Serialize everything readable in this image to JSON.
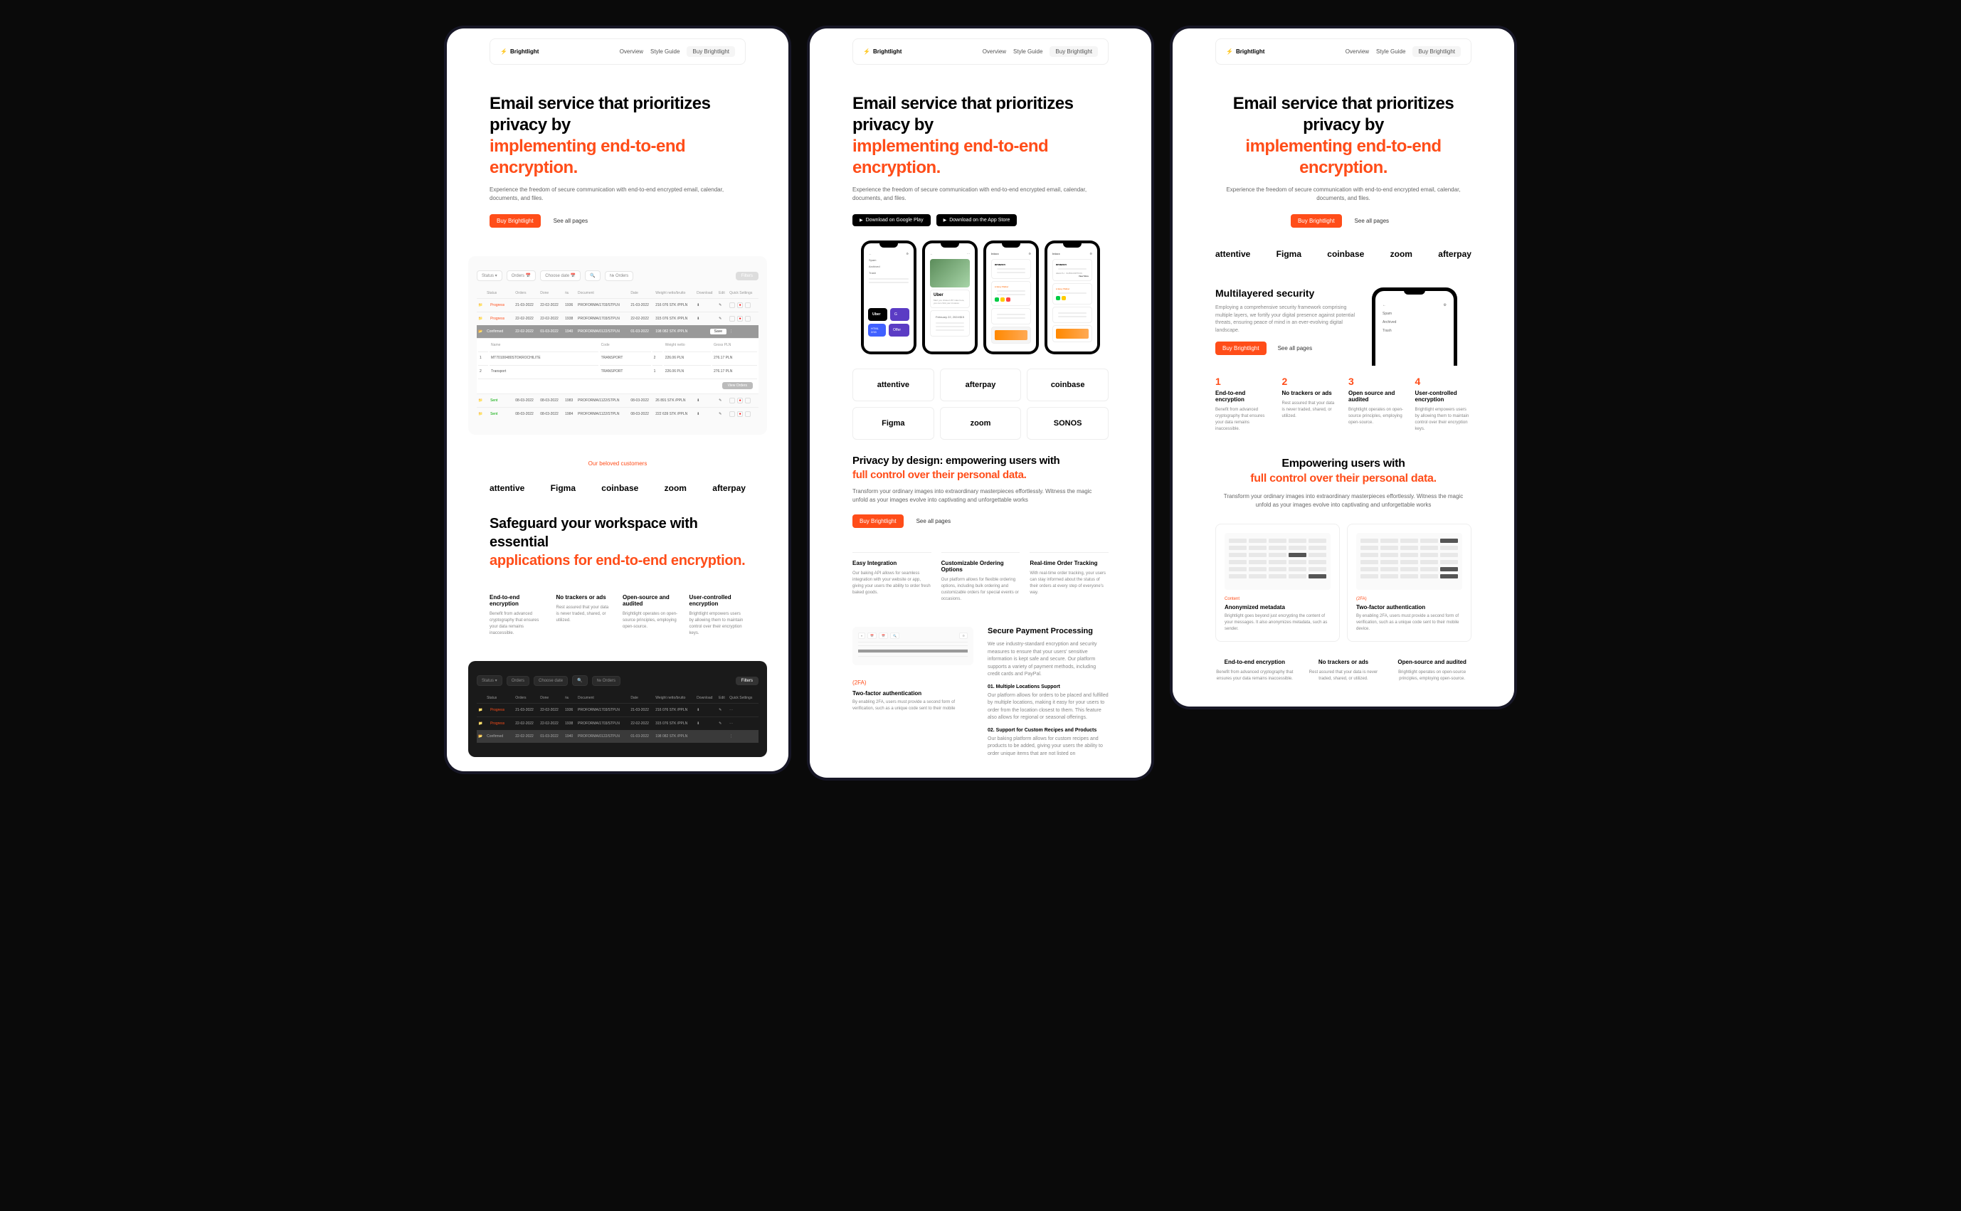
{
  "nav": {
    "brand": "Brightlight",
    "links": [
      "Overview",
      "Style Guide"
    ],
    "cta": "Buy Brightlight"
  },
  "hero": {
    "h1a": "Email service that prioritizes privacy by",
    "h1b": "implementing end-to-end encryption.",
    "sub": "Experience the freedom of secure communication with end-to-end encrypted email, calendar, documents, and files.",
    "cta": "Buy Brightlight",
    "cta2": "See all pages",
    "dl1": "Download on Google Play",
    "dl2": "Download on the App Store"
  },
  "customers": "Our beloved customers",
  "logos": [
    "attentive",
    "Figma",
    "coinbase",
    "zoom",
    "afterpay"
  ],
  "logos6": [
    "attentive",
    "afterpay",
    "coinbase",
    "Figma",
    "zoom",
    "SONOS"
  ],
  "dash": {
    "filters": [
      "Status",
      "Orders",
      "Choose date",
      "№ Orders"
    ],
    "filterBtn": "Filters",
    "cols": [
      "",
      "Status",
      "Orders",
      "Done",
      "№",
      "Document",
      "Date",
      "Weight netto/brutto",
      "Download",
      "Edit",
      "Quick Settings"
    ],
    "rows": [
      {
        "s": "Progress",
        "o": "21-03-2022",
        "d": "22-02-2022",
        "n": "1936",
        "doc": "PROFORMA/1703/STPLN",
        "dt": "21-03-2022",
        "w": "216 076 STK /PPLN"
      },
      {
        "s": "Progress",
        "o": "22-02-2022",
        "d": "22-02-2022",
        "n": "1938",
        "doc": "PROFORMA/1703/STPLN",
        "dt": "22-02-2022",
        "w": "315 076 STK /PPLN"
      },
      {
        "s": "Confirmed",
        "o": "22-02-2022",
        "d": "01-03-2022",
        "n": "1940",
        "doc": "PROFORMA/0122/STPLN",
        "dt": "01-03-2022",
        "w": "198 082 STK /PPLN",
        "exp": true,
        "sbtn": "Save"
      },
      {
        "s": "Sent",
        "o": "08-03-2022",
        "d": "08-03-2022",
        "n": "1983",
        "doc": "PROFORMA/1122/STPLN",
        "dt": "08-03-2022",
        "w": "26 891 STK /PPLN"
      },
      {
        "s": "Sent",
        "o": "08-03-2022",
        "d": "08-03-2022",
        "n": "1984",
        "doc": "PROFORMA/1122/STPLN",
        "dt": "08-03-2022",
        "w": "222 639 STK /PPLN"
      }
    ],
    "sub": {
      "cols": [
        "",
        "Name",
        "Code",
        "",
        "Weight netto",
        "Gross PLN"
      ],
      "rows": [
        [
          "1",
          "MT70100480STOKROCHILITE",
          "TRANSPORT",
          "2",
          "226.06 PLN",
          "276.17 PLN"
        ],
        [
          "2",
          "Transport",
          "TRANSPORT",
          "1",
          "226.06 PLN",
          "276.17 PLN"
        ]
      ],
      "viewBtn": "View Orders"
    }
  },
  "safeguard": {
    "h2a": "Safeguard your workspace with essential",
    "h2b": "applications for end-to-end encryption.",
    "feats": [
      {
        "t": "End-to-end encryption",
        "d": "Benefit from advanced cryptography that ensures your data remains inaccessible."
      },
      {
        "t": "No trackers or ads",
        "d": "Rest assured that your data is never traded, shared, or utilized."
      },
      {
        "t": "Open-source and audited",
        "d": "Brightlight operates on open-source principles, employing open-source."
      },
      {
        "t": "User-controlled encryption",
        "d": "Brightlight empowers users by allowing them to maintain control over their encryption keys."
      }
    ]
  },
  "phone": {
    "sidebar": [
      "Spam",
      "Archived",
      "Trash"
    ],
    "uber": {
      "t": "Uber",
      "sub": "Mail: you choked 157 rides here, you can chck your invoices",
      "date": "February 22, 2024",
      "amt": "$15"
    },
    "amz": "amazon",
    "tags": [
      "HEALTH",
      "SUBSCRIPTION"
    ],
    "more": "View More"
  },
  "privacy": {
    "h2a": "Privacy by design: empowering users with",
    "h2b": "full control over their personal data.",
    "sub": "Transform your ordinary images into extraordinary masterpieces effortlessly. Witness the magic unfold as your images evolve into captivating and unforgettable works",
    "cta": "Buy Brightlight",
    "cta2": "See all pages",
    "feats": [
      {
        "t": "Easy Integration",
        "d": "Our baking API allows for seamless integration with your website or app, giving your users the ability to order fresh baked goods."
      },
      {
        "t": "Customizable Ordering Options",
        "d": "Our platform allows for flexible ordering options, including bulk ordering and customizable orders for special events or occasions."
      },
      {
        "t": "Real-time Order Tracking",
        "d": "With real-time order tracking, your users can stay informed about the status of their orders at every step of everyone's way."
      }
    ]
  },
  "secure": {
    "h3": "Secure Payment Processing",
    "p": "We use industry-standard encryption and security measures to ensure that your users' sensitive information is kept safe and secure. Our platform supports a variety of payment methods, including credit cards and PayPal.",
    "f1": "01. Multiple Locations Support",
    "f1d": "Our platform allows for orders to be placed and fulfilled by multiple locations, making it easy for your users to order from the location closest to them. This feature also allows for regional or seasonal offerings.",
    "f2": "02. Support for Custom Recipes and Products",
    "f2d": "Our baking platform allows for custom recipes and products to be added, giving your users the ability to order unique items that are not listed on",
    "lbl": "(2FA)",
    "tfa": "Two-factor authentication",
    "tfad": "By enabling 2FA, users must provide a second form of verification, such as a unique code sent to their mobile"
  },
  "multi": {
    "h2": "Multilayered security",
    "p": "Employing a comprehensive security framework comprising multiple layers, we fortify your digital presence against potential threats, ensuring peace of mind in an ever-evolving digital landscape.",
    "cta": "Buy Brightlight",
    "cta2": "See all pages",
    "feats": [
      {
        "n": "1",
        "t": "End-to-end encryption",
        "d": "Benefit from advanced cryptography that ensures your data remains inaccessible."
      },
      {
        "n": "2",
        "t": "No trackers or ads",
        "d": "Rest assured that your data is never traded, shared, or utilized."
      },
      {
        "n": "3",
        "t": "Open source and audited",
        "d": "Brightlight operates on open-source principles, employing open-source."
      },
      {
        "n": "4",
        "t": "User-controlled encryption",
        "d": "Brightlight empowers users by allowing them to maintain control over their encryption keys."
      }
    ]
  },
  "empower": {
    "h2a": "Empowering users with",
    "h2b": "full control over their personal data.",
    "sub": "Transform your ordinary images into extraordinary masterpieces effortlessly. Witness the magic unfold as your images evolve into captivating and unforgettable works",
    "cards": [
      {
        "lbl": "Content",
        "t": "Anonymized metadata",
        "d": "Brightlight goes beyond just encrypting the content of your messages. It also anonymizes metadata, such as sender."
      },
      {
        "lbl": "(2FA)",
        "t": "Two-factor authentication",
        "d": "By enabling 2FA, users must provide a second form of verification, such as a unique code sent to their mobile device."
      }
    ],
    "feats": [
      {
        "t": "End-to-end encryption",
        "d": "Benefit from advanced cryptography that ensures your data remains inaccessible."
      },
      {
        "t": "No trackers or ads",
        "d": "Rest assured that your data is never traded, shared, or utilized."
      },
      {
        "t": "Open-source and audited",
        "d": "Brightlight operates on open-source principles, employing open-source."
      }
    ]
  }
}
